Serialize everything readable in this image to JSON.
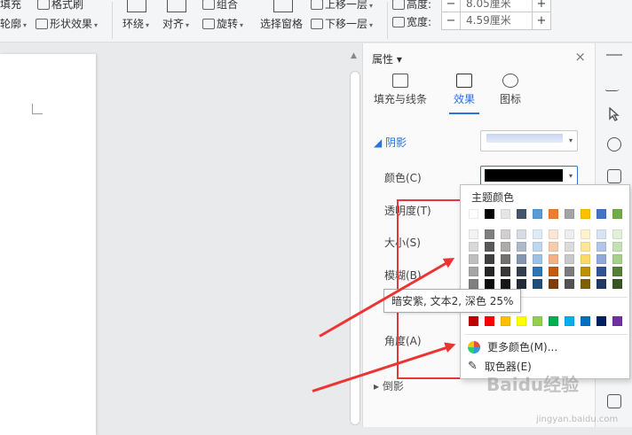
{
  "ribbon": {
    "fill_label": "填充",
    "format_painter_label": "格式刷",
    "outline_label": "轮廓",
    "shape_effect_label": "形状效果",
    "wrap_label": "环绕",
    "align_label": "对齐",
    "rotate_label": "旋转",
    "group_label": "组合",
    "selection_pane_label": "选择窗格",
    "bring_forward_label": "上移一层",
    "send_backward_label": "下移一层",
    "height_label": "高度:",
    "height_value": "8.05厘米",
    "width_label": "宽度:",
    "width_value": "4.59厘米",
    "minus_label": "−",
    "plus_label": "+"
  },
  "panel": {
    "title": "属性",
    "title_caret": "▾",
    "close_label": "×",
    "tabs": [
      {
        "label": "填充与线条",
        "active": false
      },
      {
        "label": "效果",
        "active": true
      },
      {
        "label": "图标",
        "active": false
      }
    ],
    "shadow_section": "◢ 阴影",
    "color_label": "颜色(C)",
    "transparency_label": "透明度(T)",
    "size_label": "大小(S)",
    "blur_label": "模糊(B)",
    "angle_label": "角度(A)",
    "reflection_section": "▸ 倒影",
    "selected_color": "#000000"
  },
  "color_popup": {
    "header": "主题颜色",
    "theme_row": [
      "#ffffff",
      "#000000",
      "#e7e6e6",
      "#44546a",
      "#5b9bd5",
      "#ed7d31",
      "#a5a5a5",
      "#ffc000",
      "#4472c4",
      "#70ad47"
    ],
    "shade_rows": [
      [
        "#f2f2f2",
        "#7f7f7f",
        "#d0cece",
        "#d6dce4",
        "#deebf6",
        "#fbe5d5",
        "#ededed",
        "#fff2cc",
        "#dae3f3",
        "#e2efd9"
      ],
      [
        "#d8d8d8",
        "#595959",
        "#aeabab",
        "#adb9ca",
        "#bdd7ee",
        "#f7cbac",
        "#dbdbdb",
        "#fee599",
        "#b4c6e7",
        "#c5e0b3"
      ],
      [
        "#bfbfbf",
        "#3f3f3f",
        "#757070",
        "#8496b0",
        "#9cc3e5",
        "#f4b183",
        "#c9c9c9",
        "#ffd965",
        "#8eaadb",
        "#a8d08d"
      ],
      [
        "#a5a5a5",
        "#262626",
        "#3a3838",
        "#323f4f",
        "#2e75b5",
        "#c55a11",
        "#7b7b7b",
        "#bf9000",
        "#2f5496",
        "#538135"
      ],
      [
        "#7f7f7f",
        "#0c0c0c",
        "#171616",
        "#222a35",
        "#1e4e79",
        "#833c0b",
        "#525252",
        "#7f6000",
        "#1f3864",
        "#375623"
      ]
    ],
    "standard_row": [
      "#c00000",
      "#ff0000",
      "#ffc000",
      "#ffff00",
      "#92d050",
      "#00b050",
      "#00b0f0",
      "#0070c0",
      "#002060",
      "#7030a0"
    ],
    "more_colors_label": "更多颜色(M)...",
    "eyedropper_label": "取色器(E)"
  },
  "tooltip": "暗安紫, 文本2, 深色 25%",
  "watermark": "Baidu经验",
  "watermark_url": "jingyan.baidu.com",
  "colors": {
    "accent": "#2b73d6",
    "highlight": "#e03a3a"
  }
}
